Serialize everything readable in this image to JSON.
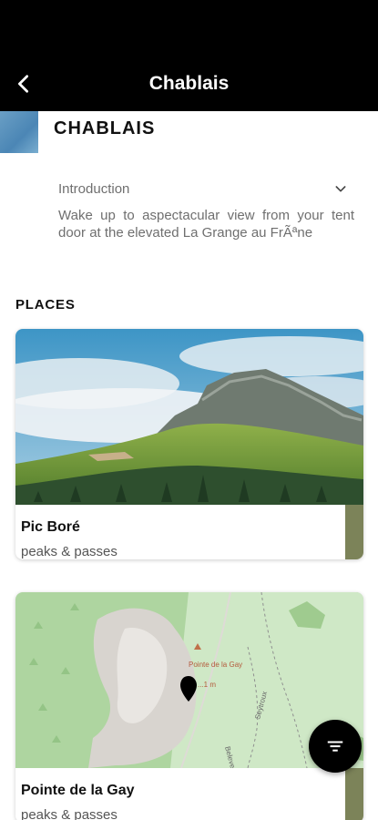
{
  "header": {
    "title": "Chablais"
  },
  "section": {
    "title": "CHABLAIS"
  },
  "intro": {
    "label": "Introduction",
    "text": "Wake up to aspectacular view from your tent door at the elevated La Grange au FrÃªne"
  },
  "places": {
    "heading": "PLACES",
    "items": [
      {
        "name": "Pic Boré",
        "category": "peaks & passes"
      },
      {
        "name": "Pointe de la Gay",
        "category": "peaks & passes"
      }
    ]
  },
  "map": {
    "poi_name": "Pointe de la Gay",
    "poi_elevation": "...1 m",
    "road_label_1": "Beleveaux",
    "road_label_2": "Seytroux"
  },
  "icons": {
    "back": "chevron-left-icon",
    "expand": "chevron-down-icon",
    "filter": "filter-icon",
    "pin": "map-pin-icon"
  },
  "colors": {
    "bar": "#000000",
    "strip": "#7c8359"
  }
}
